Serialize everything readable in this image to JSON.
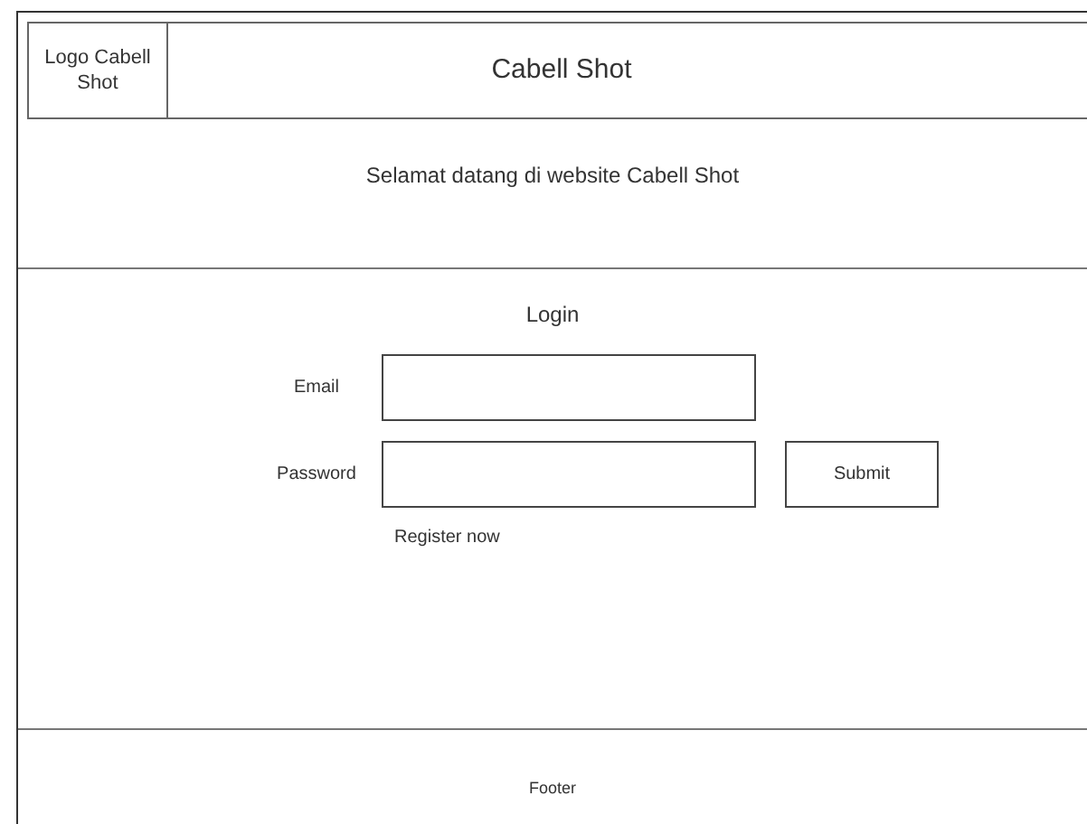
{
  "header": {
    "logo": "Logo Cabell Shot",
    "title": "Cabell Shot"
  },
  "welcome": "Selamat datang di website Cabell Shot",
  "login": {
    "title": "Login",
    "fields": [
      {
        "label": "Email"
      },
      {
        "label": "Password"
      }
    ],
    "submit": "Submit",
    "register_link": "Register now"
  },
  "footer": "Footer"
}
